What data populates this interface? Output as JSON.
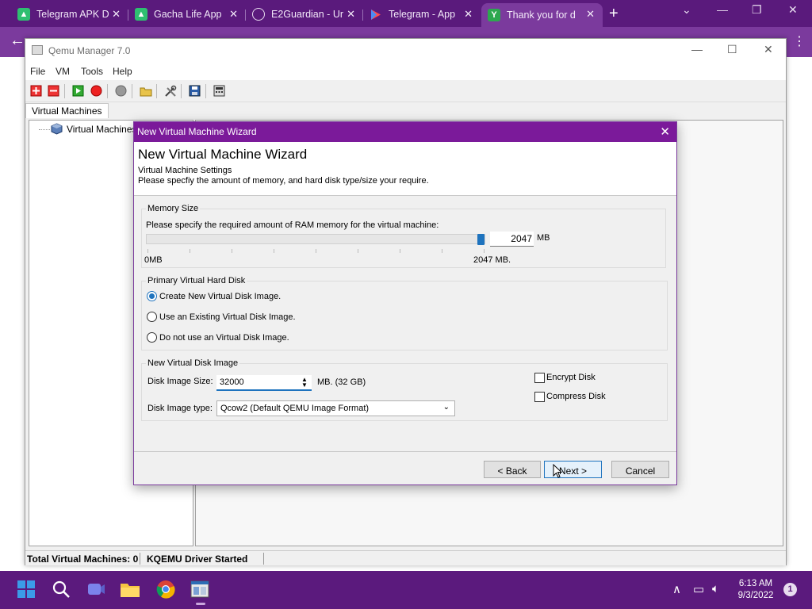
{
  "browser": {
    "tabs": [
      {
        "title": "Telegram APK D",
        "icon": "android-icon",
        "color": "#3ddc84"
      },
      {
        "title": "Gacha Life App",
        "icon": "android-icon",
        "color": "#3ddc84"
      },
      {
        "title": "E2Guardian - Ur",
        "icon": "globe-icon",
        "color": "#ffffff"
      },
      {
        "title": "Telegram - App",
        "icon": "play-store-icon",
        "color": "#ff4d4d"
      },
      {
        "title": "Thank you for d",
        "icon": "y-icon",
        "color": "#2da84f"
      }
    ],
    "active_tab": 4
  },
  "qemu": {
    "title": "Qemu Manager 7.0",
    "menu": [
      "File",
      "VM",
      "Tools",
      "Help"
    ],
    "tab_label": "Virtual Machines",
    "tree_root": "Virtual Machines",
    "status": {
      "vm_count": "Total Virtual Machines: 0",
      "driver": "KQEMU Driver Started"
    }
  },
  "wizard": {
    "window_title": "New Virtual Machine Wizard",
    "heading": "New Virtual Machine Wizard",
    "subtitle": "Virtual Machine Settings",
    "description": "Please specfiy the amount of memory, and hard disk type/size your require.",
    "memory": {
      "group": "Memory Size",
      "prompt": "Please specify the required amount of RAM memory for the virtual machine:",
      "value": "2047",
      "unit": "MB",
      "min_label": "0MB",
      "max_label": "2047 MB.",
      "slider_fraction": 1.0
    },
    "primary_disk": {
      "group": "Primary Virtual Hard Disk",
      "options": [
        "Create New Virtual Disk Image.",
        "Use an  Existing Virtual Disk Image.",
        "Do not use an Virtual Disk Image."
      ],
      "selected": 0
    },
    "new_disk": {
      "group": "New Virtual Disk Image",
      "size_label": "Disk Image Size:",
      "size_value": "32000",
      "size_unit": "MB. (32 GB)",
      "type_label": "Disk Image type:",
      "type_value": "Qcow2  (Default QEMU Image Format)",
      "encrypt_label": "Encrypt Disk",
      "compress_label": "Compress Disk",
      "encrypt_checked": false,
      "compress_checked": false
    },
    "buttons": {
      "back": "< Back",
      "next": "Next >",
      "cancel": "Cancel"
    }
  },
  "taskbar": {
    "time": "6:13 AM",
    "date": "9/3/2022",
    "notifications": "1"
  }
}
